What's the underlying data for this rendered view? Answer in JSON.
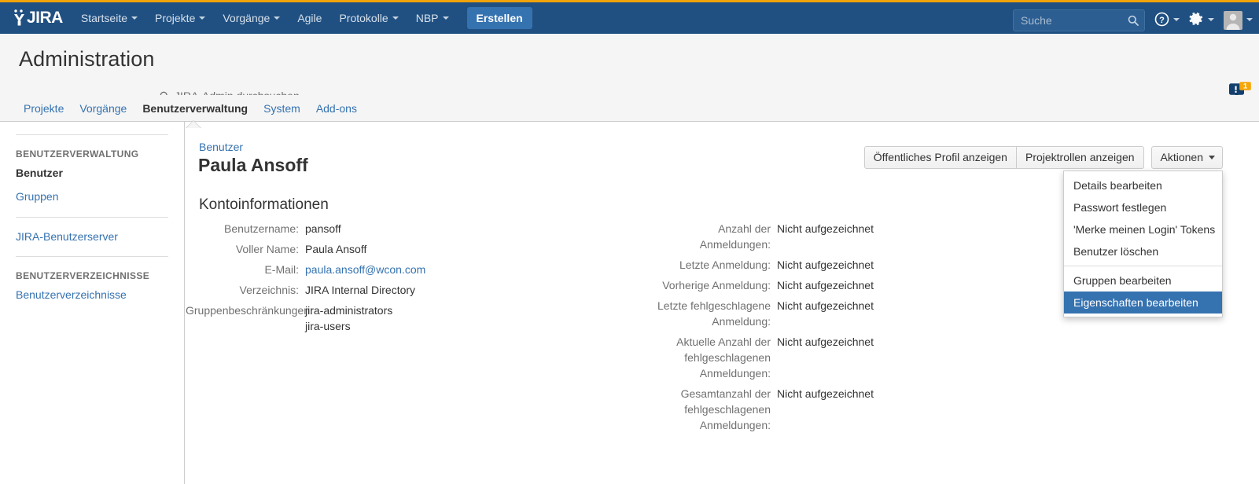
{
  "topnav": {
    "logo_text": "JIRA",
    "items": [
      {
        "label": "Startseite",
        "has_caret": true
      },
      {
        "label": "Projekte",
        "has_caret": true
      },
      {
        "label": "Vorgänge",
        "has_caret": true
      },
      {
        "label": "Agile",
        "has_caret": false
      },
      {
        "label": "Protokolle",
        "has_caret": true
      },
      {
        "label": "NBP",
        "has_caret": true
      }
    ],
    "create_label": "Erstellen",
    "search_placeholder": "Suche",
    "search_value": "",
    "help_icon": "question-mark-icon",
    "settings_icon": "gear-icon",
    "avatar_icon": "user-avatar-icon",
    "accent_color": "#205081",
    "create_color": "#3572b0",
    "topstripe_color": "#f0a30a"
  },
  "admin_header": {
    "title": "Administration",
    "search_placeholder": "JIRA-Admin durchsuchen",
    "search_icon": "search-icon",
    "feedback_icon": "feedback-bubble-icon",
    "feedback_badge": "1",
    "feedback_badge_color": "#f6a609"
  },
  "admin_tabs": [
    {
      "label": "Projekte",
      "active": false
    },
    {
      "label": "Vorgänge",
      "active": false
    },
    {
      "label": "Benutzerverwaltung",
      "active": true
    },
    {
      "label": "System",
      "active": false
    },
    {
      "label": "Add-ons",
      "active": false
    }
  ],
  "sidebar": {
    "groups": [
      {
        "heading": "BENUTZERVERWALTUNG",
        "items": [
          {
            "label": "Benutzer",
            "active": true
          },
          {
            "label": "Gruppen",
            "active": false
          }
        ]
      },
      {
        "heading": "",
        "items": [
          {
            "label": "JIRA-Benutzerserver",
            "active": false
          }
        ]
      },
      {
        "heading": "BENUTZERVERZEICHNISSE",
        "items": [
          {
            "label": "Benutzerverzeichnisse",
            "active": false
          }
        ]
      }
    ]
  },
  "main": {
    "breadcrumb": "Benutzer",
    "page_title": "Paula Ansoff",
    "section_title": "Kontoinformationen",
    "toolbar": {
      "public_profile_label": "Öffentliches Profil anzeigen",
      "project_roles_label": "Projektrollen anzeigen",
      "actions_label": "Aktionen",
      "actions_caret_icon": "chevron-down-icon"
    },
    "actions_menu": {
      "open": true,
      "highlight_color": "#3572b0",
      "items": [
        {
          "label": "Details bearbeiten",
          "selected": false,
          "separator_after": false
        },
        {
          "label": "Passwort festlegen",
          "selected": false,
          "separator_after": false
        },
        {
          "label": "'Merke meinen Login' Tokens",
          "selected": false,
          "separator_after": false
        },
        {
          "label": "Benutzer löschen",
          "selected": false,
          "separator_after": true
        },
        {
          "label": "Gruppen bearbeiten",
          "selected": false,
          "separator_after": false
        },
        {
          "label": "Eigenschaften bearbeiten",
          "selected": true,
          "separator_after": false
        }
      ]
    },
    "account_info_left": [
      {
        "term": "Benutzername:",
        "value": "pansoff",
        "is_link": false,
        "wrap": false
      },
      {
        "term": "Voller Name:",
        "value": "Paula Ansoff",
        "is_link": false,
        "wrap": false
      },
      {
        "term": "E-Mail:",
        "value": "paula.ansoff@wcon.com",
        "is_link": true,
        "wrap": false
      },
      {
        "term": "Verzeichnis:",
        "value": "JIRA Internal Directory",
        "is_link": false,
        "wrap": false
      }
    ],
    "group_memberships": {
      "term": "Gruppenbeschränkungen:",
      "values": [
        "jira-administrators",
        "jira-users"
      ]
    },
    "account_info_right": [
      {
        "term": "Anzahl der Anmeldungen:",
        "value": "Nicht aufgezeichnet",
        "wrap": true
      },
      {
        "term": "Letzte Anmeldung:",
        "value": "Nicht aufgezeichnet",
        "wrap": false
      },
      {
        "term": "Vorherige Anmeldung:",
        "value": "Nicht aufgezeichnet",
        "wrap": true
      },
      {
        "term": "Letzte fehlgeschlagene Anmeldung:",
        "value": "Nicht aufgezeichnet",
        "wrap": true
      },
      {
        "term": "Aktuelle Anzahl der fehlgeschlagenen Anmeldungen:",
        "value": "Nicht aufgezeichnet",
        "wrap": true
      },
      {
        "term": "Gesamtanzahl der fehlgeschlagenen Anmeldungen:",
        "value": "Nicht aufgezeichnet",
        "wrap": true
      }
    ]
  }
}
